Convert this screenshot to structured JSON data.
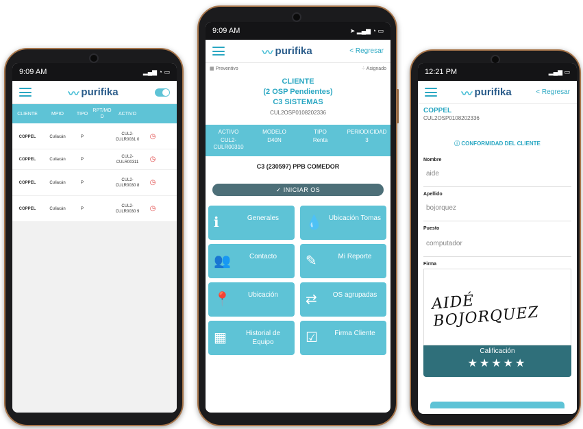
{
  "brand": {
    "logo_text": "purifika",
    "accent": "#5ec3d6",
    "dark_band": "#2f6f7a"
  },
  "phone1": {
    "time": "9:09 AM",
    "columns": [
      "CLIENTE",
      "MPIO",
      "TIPO",
      "RPT/MO D",
      "ACTIVO"
    ],
    "rows": [
      {
        "cliente": "COPPEL",
        "mpio": "Culiacán",
        "tipo": "P",
        "activo": "CUL2-CULR0031 0"
      },
      {
        "cliente": "COPPEL",
        "mpio": "Culiacán",
        "tipo": "P",
        "activo": "CUL2-CULR00311"
      },
      {
        "cliente": "COPPEL",
        "mpio": "Culiacán",
        "tipo": "P",
        "activo": "CUL2-CULR0030 8"
      },
      {
        "cliente": "COPPEL",
        "mpio": "Culiacán",
        "tipo": "P",
        "activo": "CUL2-CULR0030 9"
      }
    ]
  },
  "phone2": {
    "time": "9:09 AM",
    "back_label": "< Regresar",
    "preventivo": "Preventivo",
    "asignado": "Asignado",
    "cliente_title": "CLIENTE",
    "pendientes": "(2 OSP Pendientes)",
    "sistemas": "C3 SISTEMAS",
    "folio": "CUL2OSP0108202336",
    "info_headers": [
      "ACTIVO",
      "MODELO",
      "TIPO",
      "PERIODICIDAD"
    ],
    "info_values": [
      "CUL2-CULR00310",
      "D40N",
      "Renta",
      "3"
    ],
    "comedor": "C3 (230597)  PPB COMEDOR",
    "iniciar": "✓ INICIAR OS",
    "tiles": [
      {
        "label": "Generales",
        "icon": "info-icon"
      },
      {
        "label": "Ubicación Tomas",
        "icon": "drop-icon"
      },
      {
        "label": "Contacto",
        "icon": "users-icon"
      },
      {
        "label": "Mi Reporte",
        "icon": "edit-icon"
      },
      {
        "label": "Ubicación",
        "icon": "pin-icon"
      },
      {
        "label": "OS agrupadas",
        "icon": "merge-icon"
      },
      {
        "label": "Historial de Equipo",
        "icon": "calendar-icon"
      },
      {
        "label": "Firma Cliente",
        "icon": "checkbox-icon"
      }
    ]
  },
  "phone3": {
    "time": "12:21 PM",
    "back_label": "< Regresar",
    "client": "COPPEL",
    "folio": "CUL2OSP0108202336",
    "conformidad": "CONFORMIDAD DEL CLIENTE",
    "nombre_label": "Nombre",
    "nombre_value": "aide",
    "apellido_label": "Apellido",
    "apellido_value": "bojorquez",
    "puesto_label": "Puesto",
    "puesto_value": "computador",
    "firma_label": "Firma",
    "signature": "AIDÉ BOJORQUEZ",
    "calificacion": "Calificación",
    "stars": "★★★★★"
  }
}
